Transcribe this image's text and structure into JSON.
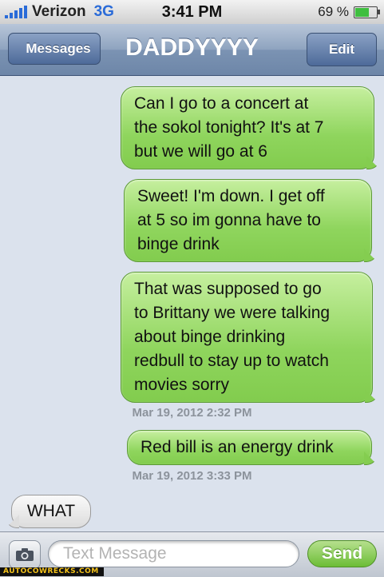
{
  "status_bar": {
    "carrier": "Verizon",
    "network": "3G",
    "time": "3:41 PM",
    "battery": "69 %",
    "battery_level": 0.69,
    "signal_bars": 5
  },
  "nav": {
    "back_label": "Messages",
    "title": "DADDYYYY",
    "edit_label": "Edit"
  },
  "messages": [
    {
      "direction": "sent",
      "lines": [
        "Can I go to a concert at",
        "the sokol tonight? It's at 7",
        "but we will go at 6"
      ]
    },
    {
      "direction": "sent",
      "lines": [
        "Sweet! I'm down. I get off",
        "at 5 so im gonna have to",
        "binge drink"
      ]
    },
    {
      "direction": "sent",
      "lines": [
        "That was supposed to go",
        "to Brittany we were talking",
        "about binge drinking",
        "redbull to stay up to watch",
        "movies sorry"
      ]
    },
    {
      "direction": "timestamp",
      "text": "Mar 19, 2012 2:32 PM"
    },
    {
      "direction": "sent",
      "lines": [
        "Red bill is an energy drink"
      ]
    },
    {
      "direction": "timestamp",
      "text": "Mar 19, 2012 3:33 PM"
    },
    {
      "direction": "received",
      "lines": [
        "WHAT"
      ]
    }
  ],
  "input_bar": {
    "placeholder": "Text Message",
    "send_label": "Send",
    "camera_icon": "camera-icon"
  },
  "watermark": "AUTOCOWRECKS.COM",
  "colors": {
    "sent_bubble": "#8fd55d",
    "received_bubble": "#e8e8e8",
    "nav_bar": "#7b93b3",
    "background": "#dbe2ed"
  }
}
